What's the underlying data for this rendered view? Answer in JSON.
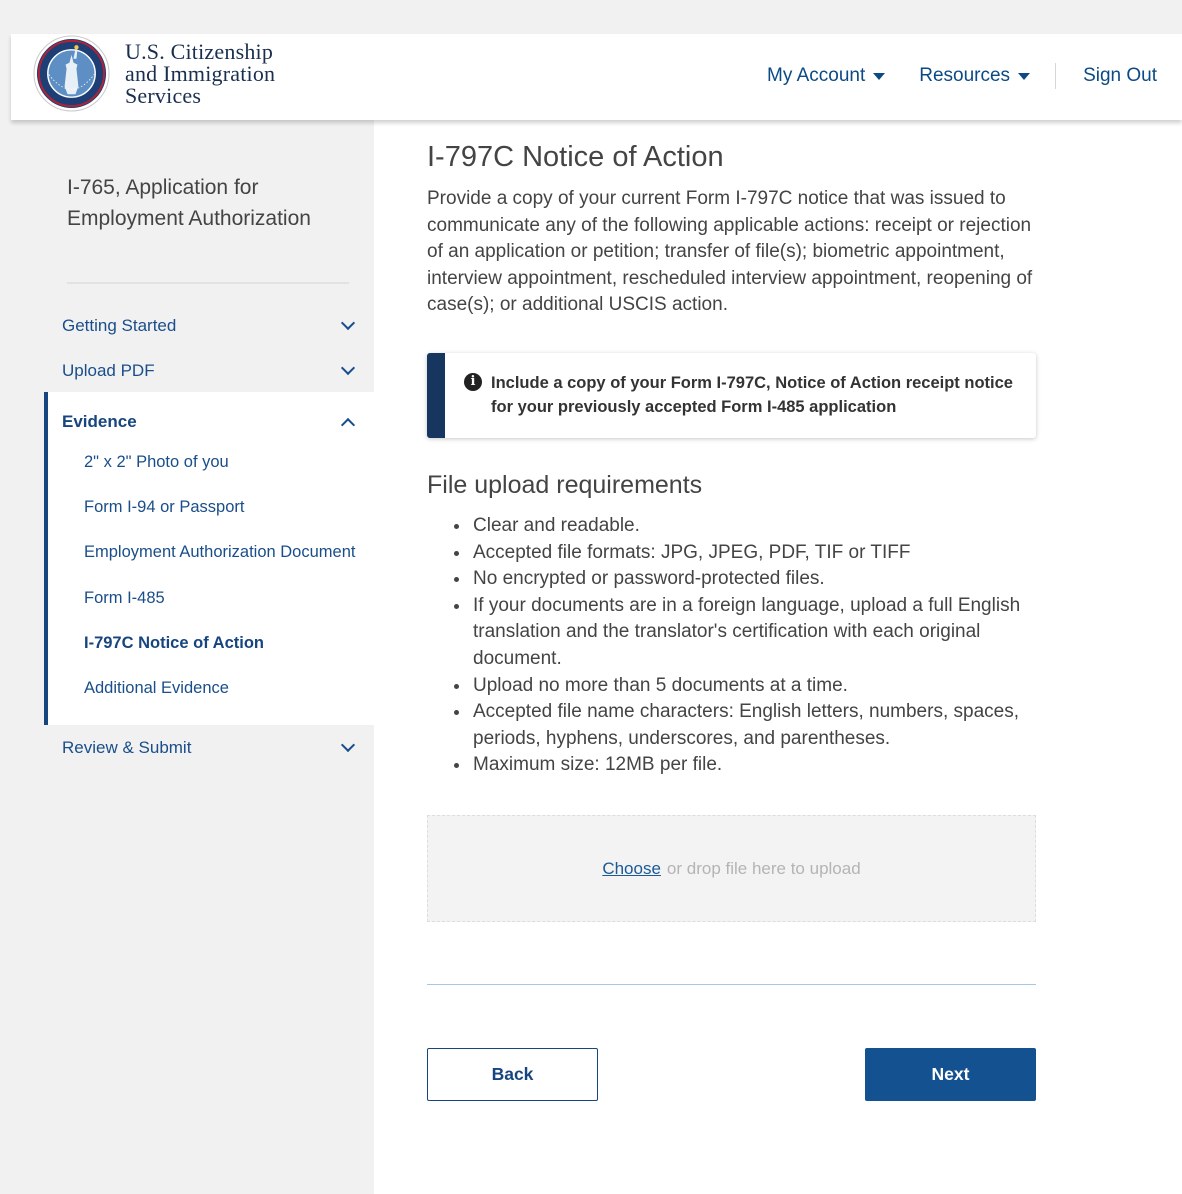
{
  "header": {
    "agency_name": [
      "U.S. Citizenship",
      "and Immigration",
      "Services"
    ],
    "nav": {
      "my_account": "My Account",
      "resources": "Resources",
      "sign_out": "Sign Out"
    }
  },
  "sidebar": {
    "title": "I-765, Application for Employment Authorization",
    "items": [
      {
        "label": "Getting Started",
        "state": "collapsed"
      },
      {
        "label": "Upload PDF",
        "state": "collapsed"
      },
      {
        "label": "Evidence",
        "state": "expanded"
      },
      {
        "label": "Review & Submit",
        "state": "collapsed"
      }
    ],
    "evidence_items": [
      {
        "label": "2\" x 2\" Photo of you",
        "active": false
      },
      {
        "label": "Form I-94 or Passport",
        "active": false
      },
      {
        "label": "Employment Authorization Document",
        "active": false
      },
      {
        "label": "Form I-485",
        "active": false
      },
      {
        "label": "I-797C Notice of Action",
        "active": true
      },
      {
        "label": "Additional Evidence",
        "active": false
      }
    ]
  },
  "main": {
    "title": "I-797C Notice of Action",
    "intro": "Provide a copy of your current Form I-797C notice that was issued to communicate any of the following applicable actions: receipt or rejection of an application or petition; transfer of file(s); biometric appointment, interview appointment, rescheduled interview appointment, reopening of case(s); or additional USCIS action.",
    "alert": "Include a copy of your Form I-797C, Notice of Action receipt notice for your previously accepted Form I-485 application",
    "requirements_title": "File upload requirements",
    "requirements": [
      "Clear and readable.",
      "Accepted file formats: JPG, JPEG, PDF, TIF or TIFF",
      "No encrypted or password-protected files.",
      "If your documents are in a foreign language, upload a full English translation and the translator's certification with each original document.",
      "Upload no more than 5 documents at a time.",
      "Accepted file name characters: English letters, numbers, spaces, periods, hyphens, underscores, and parentheses.",
      "Maximum size: 12MB per file."
    ],
    "upload": {
      "choose": "Choose",
      "hint": "or drop file here to upload"
    },
    "buttons": {
      "back": "Back",
      "next": "Next"
    }
  },
  "colors": {
    "brand_navy": "#16457f",
    "link_blue": "#1a4e8a",
    "primary_button": "#135190",
    "sidebar_bg": "#f1f1f1"
  }
}
